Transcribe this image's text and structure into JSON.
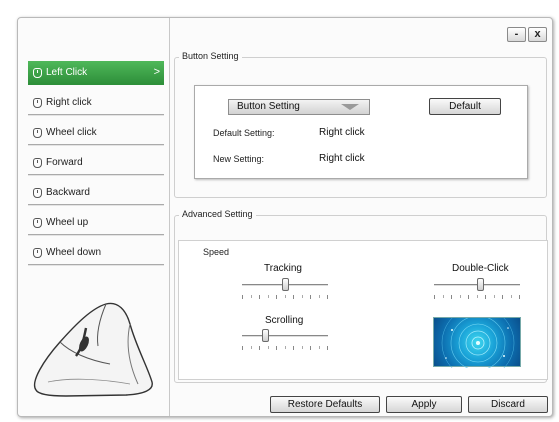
{
  "window_controls": {
    "minimize": "-",
    "close": "x"
  },
  "sidebar": {
    "items": [
      {
        "label": "Left Click",
        "active": true
      },
      {
        "label": "Right click",
        "active": false
      },
      {
        "label": "Wheel click",
        "active": false
      },
      {
        "label": "Forward",
        "active": false
      },
      {
        "label": "Backward",
        "active": false
      },
      {
        "label": "Wheel up",
        "active": false
      },
      {
        "label": "Wheel down",
        "active": false
      }
    ],
    "active_chevron": ">"
  },
  "button_setting": {
    "group_title": "Button Setting",
    "dropdown_value": "Button Setting",
    "default_button": "Default",
    "default_label": "Default Setting:",
    "default_value": "Right click",
    "new_label": "New Setting:",
    "new_value": "Right click"
  },
  "advanced_setting": {
    "group_title": "Advanced Setting",
    "speed_label": "Speed",
    "tracking_label": "Tracking",
    "tracking_level": 0.5,
    "scrolling_label": "Scrolling",
    "scrolling_level": 0.25,
    "double_click_label": "Double-Click",
    "double_click_level": 0.55
  },
  "footer": {
    "restore_defaults": "Restore Defaults",
    "apply": "Apply",
    "discard": "Discard"
  },
  "colors": {
    "active_item": "#3aa047",
    "preview_inner": "#3fd7ef",
    "preview_outer": "#0a4f8c"
  }
}
